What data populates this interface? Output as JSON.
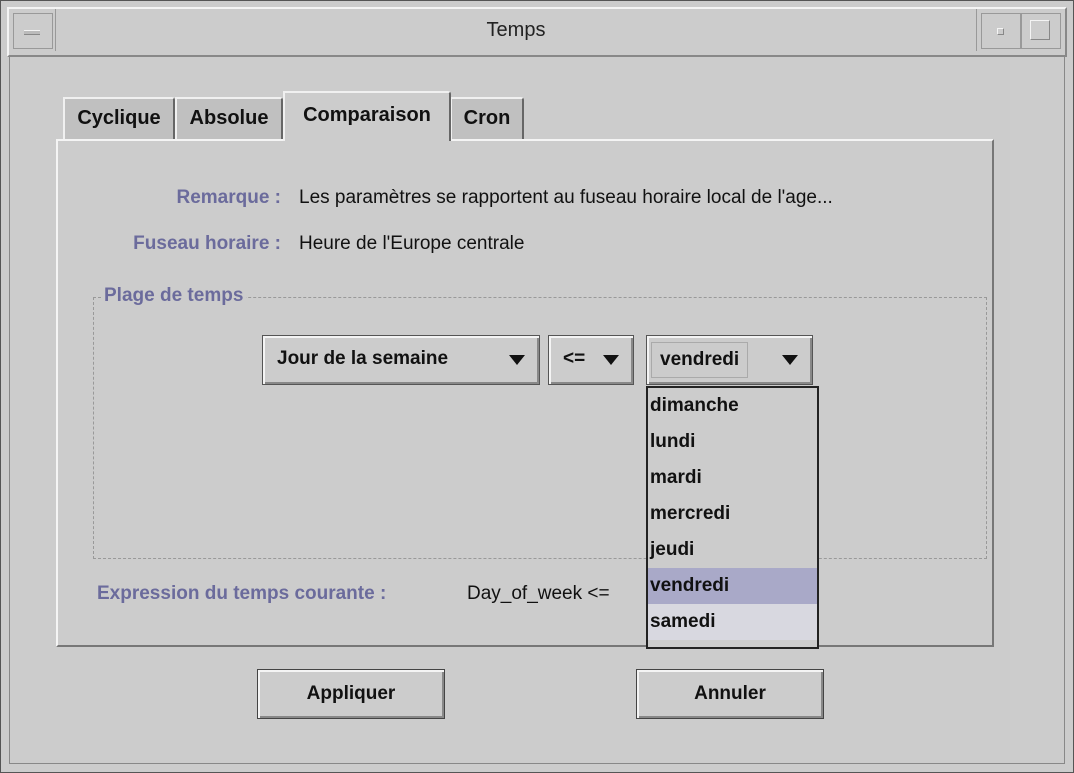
{
  "window": {
    "title": "Temps"
  },
  "tabs": [
    {
      "label": "Cyclique"
    },
    {
      "label": "Absolue"
    },
    {
      "label": "Comparaison",
      "active": true
    },
    {
      "label": "Cron"
    }
  ],
  "info": {
    "remark_label": "Remarque :",
    "remark_value": "Les paramètres se rapportent au fuseau horaire local de l'age...",
    "timezone_label": "Fuseau horaire :",
    "timezone_value": "Heure de l'Europe centrale"
  },
  "range_group": {
    "title": "Plage de temps",
    "field_select": "Jour de la semaine",
    "operator_select": "<=",
    "value_select": "vendredi",
    "options": [
      "dimanche",
      "lundi",
      "mardi",
      "mercredi",
      "jeudi",
      "vendredi",
      "samedi"
    ],
    "selected_option": "vendredi"
  },
  "expression": {
    "label": "Expression du temps courante :",
    "value": "Day_of_week <="
  },
  "buttons": {
    "apply": "Appliquer",
    "cancel": "Annuler"
  },
  "colors": {
    "accent_label": "#6b6b9c",
    "selection": "#a9a9c8",
    "background": "#cccccc"
  }
}
